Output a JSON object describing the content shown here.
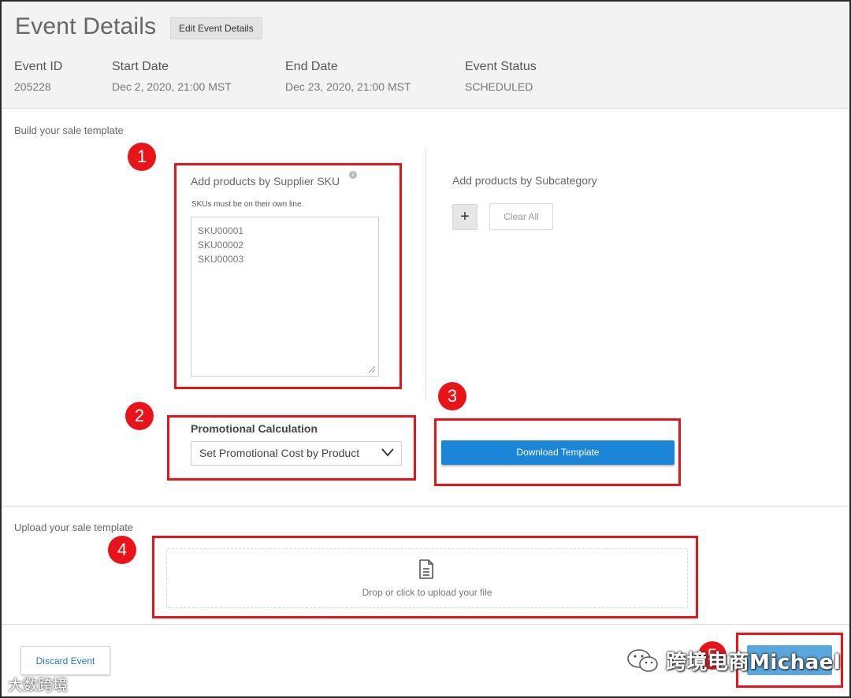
{
  "header": {
    "title": "Event Details",
    "edit_label": "Edit Event Details",
    "fields": [
      {
        "label": "Event ID",
        "value": "205228"
      },
      {
        "label": "Start Date",
        "value": "Dec 2, 2020, 21:00 MST"
      },
      {
        "label": "End Date",
        "value": "Dec 23, 2020, 21:00 MST"
      },
      {
        "label": "Event Status",
        "value": "SCHEDULED"
      }
    ]
  },
  "build": {
    "section_label": "Build your sale template",
    "sku_title": "Add products by Supplier SKU",
    "sku_hint": "SKUs must be on their own line.",
    "sku_value": "SKU00001\nSKU00002\nSKU00003",
    "subcategory_title": "Add products by Subcategory",
    "add_label": "+",
    "clear_label": "Clear All",
    "promo_label": "Promotional Calculation",
    "promo_selected": "Set Promotional Cost by Product",
    "download_label": "Download Template"
  },
  "upload": {
    "section_label": "Upload your sale template",
    "drop_text": "Drop or click to upload your file"
  },
  "footer": {
    "discard_label": "Discard Event"
  },
  "annotations": [
    "1",
    "2",
    "3",
    "4",
    "5"
  ],
  "watermark": {
    "right": "跨境电商Michael",
    "left": "大数跨境"
  },
  "colors": {
    "annotation_red": "#e8141a",
    "primary_blue": "#1b85d8",
    "link_blue": "#1b7cc4",
    "header_bg": "#f3f3f3"
  }
}
